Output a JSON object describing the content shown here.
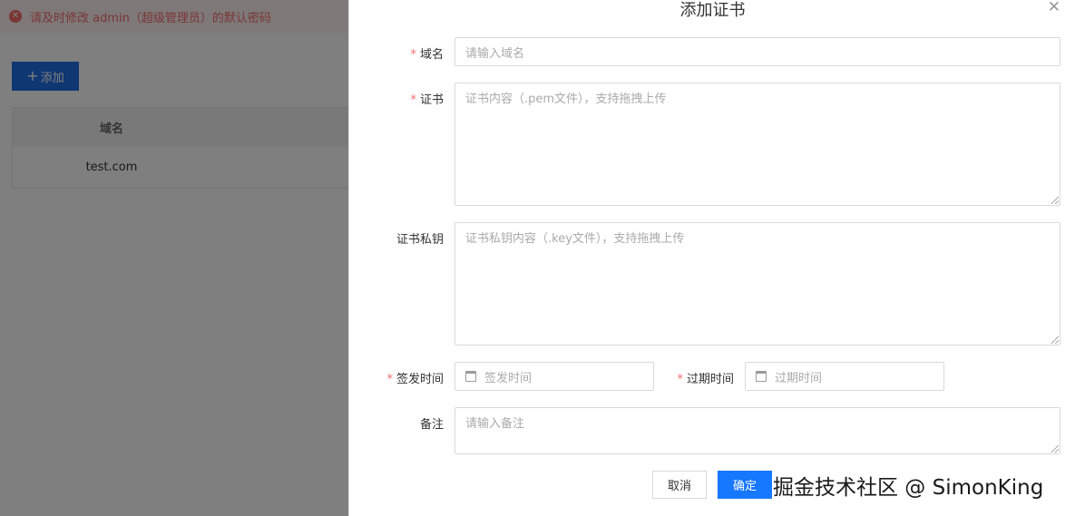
{
  "alert": {
    "message": "请及时修改 admin（超级管理员）的默认密码",
    "color": "#f56c6c"
  },
  "toolbar": {
    "add_label": "添加"
  },
  "table": {
    "header": "域名",
    "rows": [
      "test.com"
    ]
  },
  "drawer": {
    "title": "添加证书",
    "fields": {
      "domain": {
        "label": "域名",
        "required": true,
        "placeholder": "请输入域名"
      },
      "certificate": {
        "label": "证书",
        "required": true,
        "placeholder": "证书内容（.pem文件），支持拖拽上传"
      },
      "private_key": {
        "label": "证书私钥",
        "required": false,
        "placeholder": "证书私钥内容（.key文件），支持拖拽上传"
      },
      "issue_time": {
        "label": "签发时间",
        "required": true,
        "placeholder": "签发时间"
      },
      "expire_time": {
        "label": "过期时间",
        "required": true,
        "placeholder": "过期时间"
      },
      "remark": {
        "label": "备注",
        "required": false,
        "placeholder": "请输入备注"
      }
    },
    "buttons": {
      "cancel": "取消",
      "confirm": "确定"
    },
    "primary_color": "#1677ff"
  },
  "watermark": "掘金技术社区 @ SimonKing"
}
